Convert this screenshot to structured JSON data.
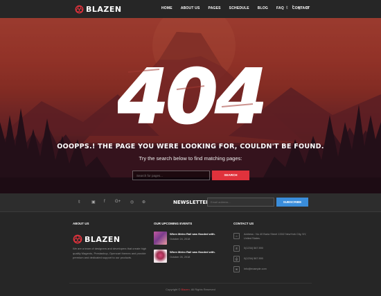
{
  "header": {
    "logo_text": "BLAZEN",
    "nav": [
      "HOME",
      "ABOUT US",
      "PAGES",
      "SCHEDULE",
      "BLOG",
      "FAQ",
      "CONTACT"
    ],
    "social": [
      "twitter-icon",
      "facebook-icon",
      "instagram-icon",
      "dribbble-icon"
    ],
    "social_glyphs": [
      "𝕥",
      "f",
      "◎",
      "⊛"
    ]
  },
  "hero": {
    "error_code": "404",
    "headline": "OOOPPS.! THE PAGE YOU WERE LOOKING FOR, COULDN'T BE FOUND.",
    "subline": "Try the search below to find matching pages:",
    "search_placeholder": "Search for pages...",
    "search_button": "SEARCH"
  },
  "newsletter": {
    "social_glyphs": [
      "𝕥",
      "▣",
      "f",
      "G+",
      "◎",
      "⊛"
    ],
    "label": "NEWSLETTER",
    "email_placeholder": "Email address...",
    "subscribe_button": "SUBSCRIBE"
  },
  "footer": {
    "about_title": "ABOUT US",
    "logo_text": "BLAZEN",
    "about_text": "We are a team of designers and developers that create high quality Magento, Prestashop, Opencart themes and provide premium and dedicated support to our products.",
    "events_title": "OUR UPCOMING EVENTS",
    "events": [
      {
        "title": "When Metro Rail was flooded with.",
        "date": "October 24, 2018"
      },
      {
        "title": "When Metro Rail was flooded with.",
        "date": "October 26, 2018"
      }
    ],
    "contact_title": "CONTACT US",
    "contacts": [
      {
        "icon": "map-pin-icon",
        "glyph": "⌂",
        "text": "Address : No 40 Baria Street 133/2 NewYork City, NY, United States."
      },
      {
        "icon": "phone-icon",
        "glyph": "✆",
        "text": "0(1234) 567 890"
      },
      {
        "icon": "fax-icon",
        "glyph": "⎙",
        "text": "0(1234) 567 890"
      },
      {
        "icon": "email-icon",
        "glyph": "✉",
        "text": "Info@example.com"
      }
    ],
    "copyright_prefix": "Copyright © ",
    "copyright_brand": "Blazen",
    "copyright_suffix": ". All Rights Reserved"
  },
  "colors": {
    "accent_red": "#e0323c",
    "subscribe_blue": "#3a8ddb"
  }
}
